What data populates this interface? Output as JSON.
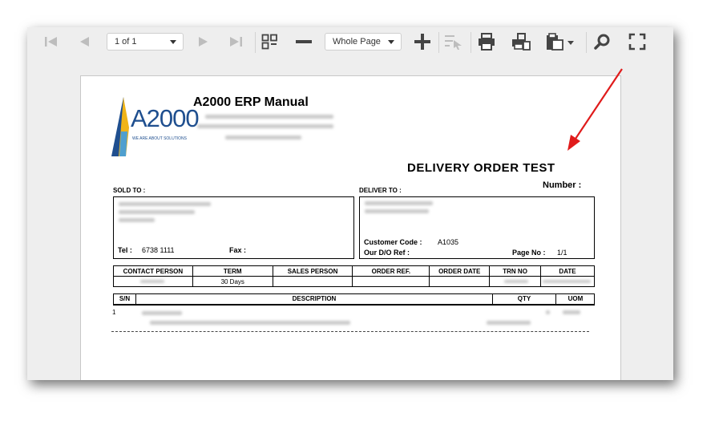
{
  "toolbar": {
    "page_selector": "1 of 1",
    "zoom_selector": "Whole Page"
  },
  "report": {
    "company_title": "A2000 ERP Manual",
    "logo_text": "A2000",
    "logo_tagline": "WE ARE ABOUT SOLUTIONS",
    "doc_title": "DELIVERY ORDER TEST",
    "number_label": "Number :",
    "sold_to_label": "SOLD TO :",
    "deliver_to_label": "DELIVER TO :",
    "tel_label": "Tel :",
    "tel_value": "6738 1111",
    "fax_label": "Fax :",
    "customer_code_label": "Customer Code :",
    "customer_code_value": "A1035",
    "our_do_ref_label": "Our D/O Ref :",
    "page_no_label": "Page No :",
    "page_no_value": "1/1",
    "info_headers": [
      "CONTACT PERSON",
      "TERM",
      "SALES PERSON",
      "ORDER REF.",
      "ORDER DATE",
      "TRN NO",
      "DATE"
    ],
    "info_values": [
      "",
      "30 Days",
      "",
      "",
      "",
      "",
      ""
    ],
    "item_headers": [
      "S/N",
      "DESCRIPTION",
      "QTY",
      "UOM"
    ],
    "line_sn": "1"
  },
  "colors": {
    "arrow": "#e01b1b",
    "toolbar_icon": "#444444",
    "toolbar_icon_disabled": "#bdbdbd"
  },
  "icons": [
    "first-page-icon",
    "prev-page-icon",
    "next-page-icon",
    "last-page-icon",
    "multi-page-icon",
    "zoom-out-icon",
    "zoom-in-icon",
    "select-tool-icon",
    "print-icon",
    "print-page-icon",
    "export-icon",
    "search-icon",
    "fullscreen-icon"
  ]
}
